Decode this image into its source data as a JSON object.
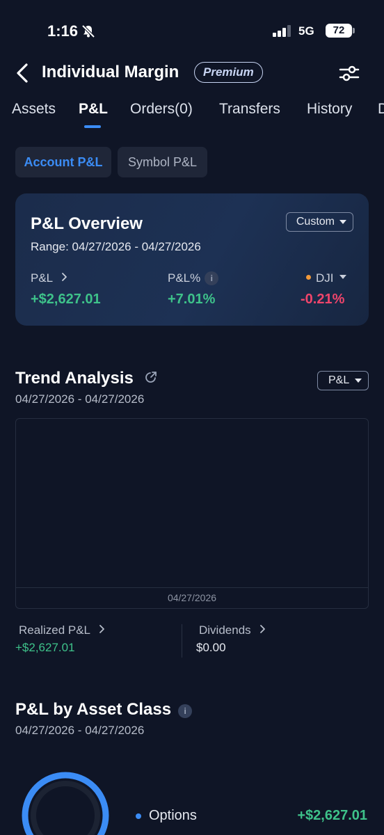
{
  "status_bar": {
    "time": "1:16",
    "network": "5G",
    "battery": "72"
  },
  "header": {
    "title": "Individual Margin",
    "badge": "Premium"
  },
  "tabs": [
    {
      "label": "Assets"
    },
    {
      "label": "P&L"
    },
    {
      "label": "Orders(0)"
    },
    {
      "label": "Transfers"
    },
    {
      "label": "History"
    },
    {
      "label": "D"
    }
  ],
  "segments": [
    {
      "label": "Account P&L"
    },
    {
      "label": "Symbol P&L"
    }
  ],
  "overview": {
    "title": "P&L Overview",
    "range": "Range: 04/27/2026 - 04/27/2026",
    "range_selector": "Custom",
    "pl_label": "P&L",
    "pl_value": "+$2,627.01",
    "plpct_label": "P&L%",
    "plpct_value": "+7.01%",
    "benchmark_label": "DJI",
    "benchmark_value": "-0.21%"
  },
  "trend": {
    "title": "Trend Analysis",
    "range": "04/27/2026 - 04/27/2026",
    "metric_selector": "P&L",
    "x_tick": "04/27/2026",
    "realized_label": "Realized P&L",
    "realized_value": "+$2,627.01",
    "dividends_label": "Dividends",
    "dividends_value": "$0.00"
  },
  "asset_class": {
    "title": "P&L by Asset Class",
    "range": "04/27/2026 - 04/27/2026",
    "items": [
      {
        "label": "Options",
        "value": "+$2,627.01"
      }
    ]
  },
  "colors": {
    "background": "#0f1526",
    "accent": "#3b8cf5",
    "positive": "#3ec28a",
    "negative": "#f0456b"
  }
}
